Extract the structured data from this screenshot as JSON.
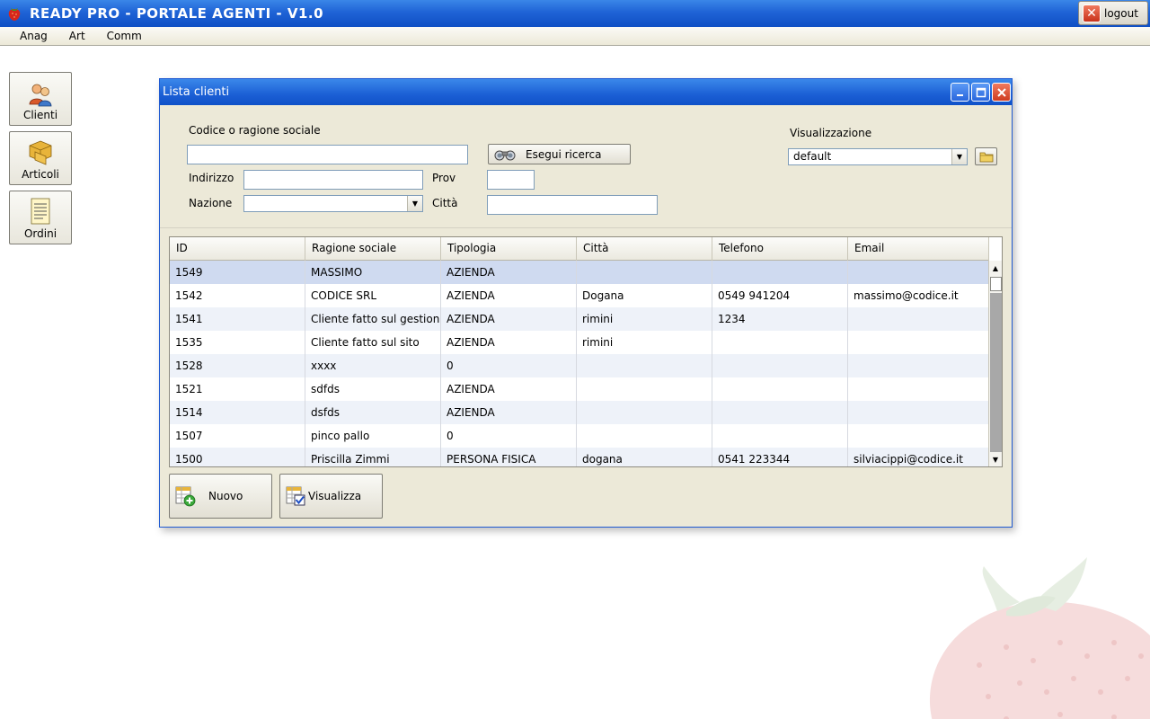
{
  "app": {
    "title": "READY PRO - PORTALE AGENTI - V1.0",
    "logout_label": "logout"
  },
  "menu": [
    "Anag",
    "Art",
    "Comm"
  ],
  "sidebar": {
    "items": [
      {
        "label": "Clienti",
        "icon": "clients-icon"
      },
      {
        "label": "Articoli",
        "icon": "boxes-icon"
      },
      {
        "label": "Ordini",
        "icon": "document-icon"
      }
    ]
  },
  "window": {
    "title": "Lista clienti",
    "form": {
      "codice_label": "Codice o ragione sociale",
      "codice_value": "",
      "search_label": "Esegui ricerca",
      "indirizzo_label": "Indirizzo",
      "indirizzo_value": "",
      "prov_label": "Prov",
      "prov_value": "",
      "nazione_label": "Nazione",
      "nazione_value": "",
      "citta_label": "Città",
      "citta_value": "",
      "visualizzazione_label": "Visualizzazione",
      "visualizzazione_value": "default"
    },
    "table": {
      "columns": [
        "ID",
        "Ragione sociale",
        "Tipologia",
        "Città",
        "Telefono",
        "Email"
      ],
      "rows": [
        [
          "1549",
          "MASSIMO",
          "AZIENDA",
          "",
          "",
          ""
        ],
        [
          "1542",
          "CODICE SRL",
          "AZIENDA",
          "Dogana",
          "0549 941204",
          "massimo@codice.it"
        ],
        [
          "1541",
          "Cliente fatto sul gestiona",
          "AZIENDA",
          "rimini",
          "1234",
          ""
        ],
        [
          "1535",
          "Cliente fatto sul sito",
          "AZIENDA",
          "rimini",
          "",
          ""
        ],
        [
          "1528",
          "xxxx",
          "0",
          "",
          "",
          ""
        ],
        [
          "1521",
          "sdfds",
          "AZIENDA",
          "",
          "",
          ""
        ],
        [
          "1514",
          "dsfds",
          "AZIENDA",
          "",
          "",
          ""
        ],
        [
          "1507",
          "pinco pallo",
          "0",
          "",
          "",
          ""
        ],
        [
          "1500",
          "Priscilla Zimmi",
          "PERSONA FISICA",
          "dogana",
          "0541 223344",
          "silviacippi@codice.it"
        ]
      ],
      "selected_row": 0
    },
    "buttons": {
      "nuovo_label": "Nuovo",
      "visualizza_label": "Visualizza"
    }
  },
  "colors": {
    "titlebar": "#1f63d6",
    "window_bg": "#ece9d8",
    "selected_row": "#cfdaf0"
  }
}
